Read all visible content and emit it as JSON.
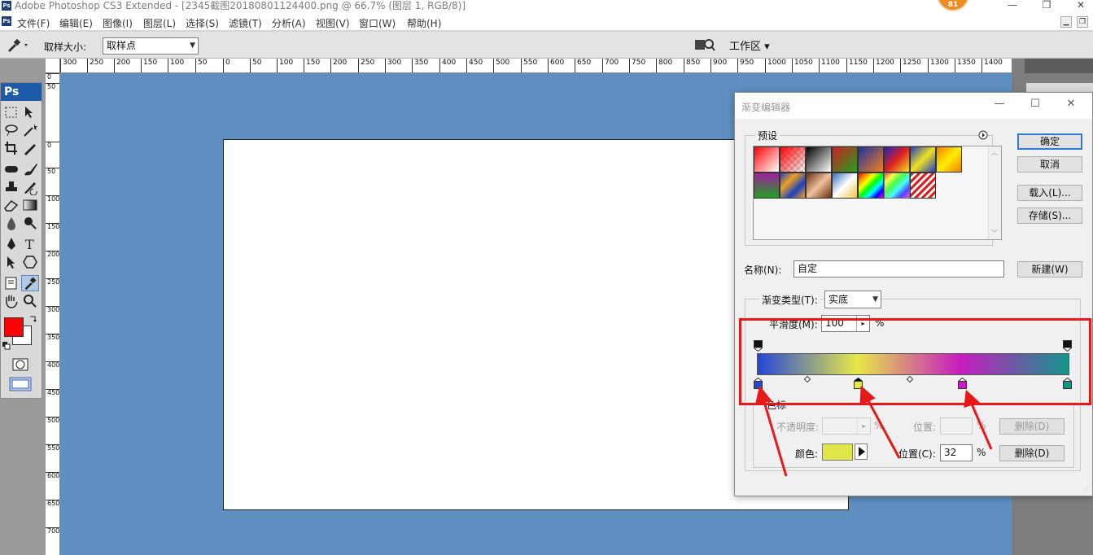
{
  "app": {
    "title": "Adobe Photoshop CS3 Extended - [2345截图20180801124400.png @ 66.7% (图层 1, RGB/8)]",
    "badge": "81",
    "logo": "Ps"
  },
  "menu": [
    "文件(F)",
    "编辑(E)",
    "图像(I)",
    "图层(L)",
    "选择(S)",
    "滤镜(T)",
    "分析(A)",
    "视图(V)",
    "窗口(W)",
    "帮助(H)"
  ],
  "options": {
    "sample_size_label": "取样大小:",
    "sample_size_value": "取样点",
    "workspace_label": "工作区 ▾"
  },
  "ruler": {
    "h_ticks": [
      "300",
      "250",
      "200",
      "150",
      "100",
      "50",
      "0",
      "50",
      "100",
      "150",
      "200",
      "250",
      "300",
      "350",
      "400",
      "450",
      "500",
      "550",
      "600",
      "650",
      "700",
      "750",
      "800",
      "850",
      "900",
      "950",
      "1000",
      "1050",
      "1100",
      "1150",
      "1200",
      "1250",
      "1300",
      "1350",
      "1400"
    ],
    "v_ticks": [
      "0",
      "50",
      "0",
      "50",
      "100",
      "150",
      "200",
      "250",
      "300",
      "350",
      "400",
      "450",
      "500",
      "550",
      "600",
      "650",
      "700"
    ]
  },
  "colors": {
    "foreground": "#ff0000",
    "background": "#ffffff",
    "canvas_bg": "#5f8fc0"
  },
  "dialog": {
    "title": "渐变编辑器",
    "presets_label": "预设",
    "ok": "确定",
    "cancel": "取消",
    "load": "载入(L)...",
    "save": "存储(S)...",
    "name_label": "名称(N):",
    "name_value": "自定",
    "new_button": "新建(W)",
    "type_label": "渐变类型(T):",
    "type_value": "实底",
    "smooth_label": "平滑度(M):",
    "smooth_value": "100",
    "percent": "%",
    "stops_label": "色标",
    "opacity_label": "不透明度:",
    "location_label": "位置:",
    "delete_label": "删除(D)",
    "color_label": "颜色:",
    "color_location_label": "位置(C):",
    "color_location_value": "32",
    "selected_color": "#e0e64a",
    "color_stops": [
      {
        "location": 0,
        "color": "#2546d8"
      },
      {
        "location": 32,
        "color": "#e6e848"
      },
      {
        "location": 65,
        "color": "#c81cc0"
      },
      {
        "location": 100,
        "color": "#12968a"
      }
    ],
    "midpoints": [
      16,
      49
    ],
    "opacity_stops": [
      {
        "location": 0,
        "opacity": 100
      },
      {
        "location": 100,
        "opacity": 100
      }
    ]
  }
}
